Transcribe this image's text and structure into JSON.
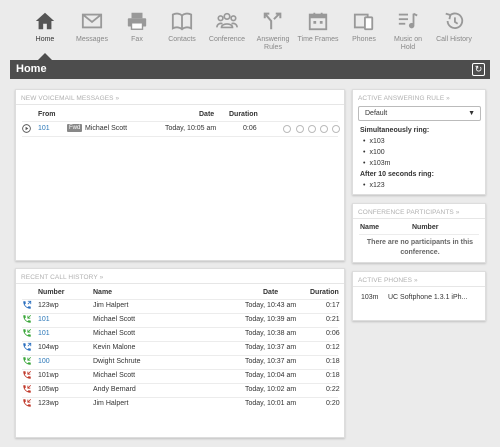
{
  "nav": {
    "items": [
      {
        "label": "Home",
        "icon": "home-icon",
        "active": true
      },
      {
        "label": "Messages",
        "icon": "envelope-icon"
      },
      {
        "label": "Fax",
        "icon": "fax-icon"
      },
      {
        "label": "Contacts",
        "icon": "book-icon"
      },
      {
        "label": "Conference",
        "icon": "group-icon"
      },
      {
        "label": "Answering Rules",
        "icon": "route-icon"
      },
      {
        "label": "Time Frames",
        "icon": "calendar-icon"
      },
      {
        "label": "Phones",
        "icon": "phones-icon"
      },
      {
        "label": "Music on Hold",
        "icon": "music-icon"
      },
      {
        "label": "Call History",
        "icon": "history-icon"
      }
    ]
  },
  "page": {
    "title": "Home"
  },
  "voicemail": {
    "heading": "New Voicemail Messages",
    "columns": {
      "from": "From",
      "date": "Date",
      "duration": "Duration"
    },
    "rows": [
      {
        "number": "101",
        "badge": "Fwd",
        "name": "Michael Scott",
        "date": "Today, 10:05 am",
        "duration": "0:06"
      }
    ]
  },
  "answering": {
    "heading": "Active Answering Rule",
    "selected": "Default",
    "simultaneous_label": "Simultaneously ring:",
    "simultaneous": [
      "x103",
      "x100",
      "x103m"
    ],
    "after_label": "After 10 seconds ring:",
    "after": [
      "x123"
    ]
  },
  "conference": {
    "heading": "Conference Participants",
    "columns": {
      "name": "Name",
      "number": "Number"
    },
    "empty": "There are no participants in this conference."
  },
  "phones": {
    "heading": "Active Phones",
    "rows": [
      {
        "ext": "103m",
        "device": "UC Softphone 1.3.1 iPh..."
      }
    ]
  },
  "calls": {
    "heading": "Recent Call History",
    "columns": {
      "number": "Number",
      "name": "Name",
      "date": "Date",
      "duration": "Duration"
    },
    "rows": [
      {
        "dir": "outgoing",
        "number": "123wp",
        "link": false,
        "name": "Jim Halpert",
        "date": "Today, 10:43 am",
        "duration": "0:17"
      },
      {
        "dir": "incoming",
        "number": "101",
        "link": true,
        "name": "Michael Scott",
        "date": "Today, 10:39 am",
        "duration": "0:21"
      },
      {
        "dir": "incoming",
        "number": "101",
        "link": true,
        "name": "Michael Scott",
        "date": "Today, 10:38 am",
        "duration": "0:06"
      },
      {
        "dir": "outgoing",
        "number": "104wp",
        "link": false,
        "name": "Kevin Malone",
        "date": "Today, 10:37 am",
        "duration": "0:12"
      },
      {
        "dir": "incoming",
        "number": "100",
        "link": true,
        "name": "Dwight Schrute",
        "date": "Today, 10:37 am",
        "duration": "0:18"
      },
      {
        "dir": "missed",
        "number": "101wp",
        "link": false,
        "name": "Michael Scott",
        "date": "Today, 10:04 am",
        "duration": "0:18"
      },
      {
        "dir": "missed",
        "number": "105wp",
        "link": false,
        "name": "Andy Bernard",
        "date": "Today, 10:02 am",
        "duration": "0:22"
      },
      {
        "dir": "missed",
        "number": "123wp",
        "link": false,
        "name": "Jim Halpert",
        "date": "Today, 10:01 am",
        "duration": "0:20"
      }
    ]
  },
  "colors": {
    "incoming": "#3aa63a",
    "outgoing": "#2b6fbf",
    "missed": "#c0392b",
    "accent": "#2a77b8",
    "titlebar": "#4d4d4d"
  }
}
